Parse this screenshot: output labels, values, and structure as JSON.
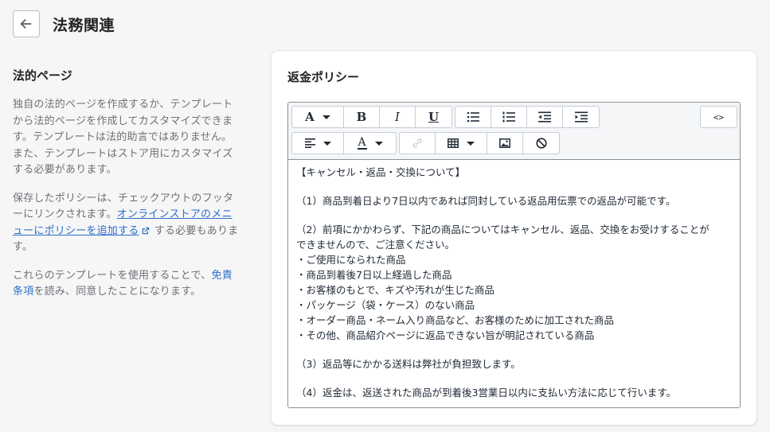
{
  "header": {
    "title": "法務関連",
    "back_icon": "arrow-left-icon"
  },
  "sidebar": {
    "heading": "法的ページ",
    "para1": "独自の法的ページを作成するか、テンプレートから法的ページを作成してカスタマイズできます。テンプレートは法的助言ではありません。また、テンプレートはストア用にカスタマイズする必要があります。",
    "para2_before": "保存したポリシーは、チェックアウトのフッターにリンクされます。",
    "para2_link": "オンラインストアのメニューにポリシーを追加する",
    "para2_after": " する必要もあります。",
    "para3_before": "これらのテンプレートを使用することで、",
    "para3_link": "免責条項",
    "para3_after": "を読み、同意したことになります。",
    "link_color": "#2c6ecb"
  },
  "card": {
    "title": "返金ポリシー"
  },
  "toolbar": {
    "font_label": "A",
    "bold_label": "B",
    "italic_label": "I",
    "underline_label": "U",
    "html_label": "<>",
    "color_label": "A"
  },
  "policy": {
    "heading": "【キャンセル・返品・交換について】",
    "p1": "（1）商品到着日より7日以内であれば同封している返品用伝票での返品が可能です。",
    "p2_l1": "（2）前項にかかわらず、下記の商品についてはキャンセル、返品、交換をお受けすることが",
    "p2_l2": "できませんので、ご注意ください。",
    "items": [
      "・ご使用になられた商品",
      "・商品到着後7日以上経過した商品",
      "・お客様のもとで、キズや汚れが生じた商品",
      "・パッケージ（袋・ケース）のない商品",
      "・オーダー商品・ネーム入り商品など、お客様のために加工された商品",
      "・その他、商品紹介ページに返品できない旨が明記されている商品"
    ],
    "p3": "（3）返品等にかかる送料は弊社が負担致します。",
    "p4": "（4）返金は、返送された商品が到着後3営業日以内に支払い方法に応じて行います。"
  }
}
